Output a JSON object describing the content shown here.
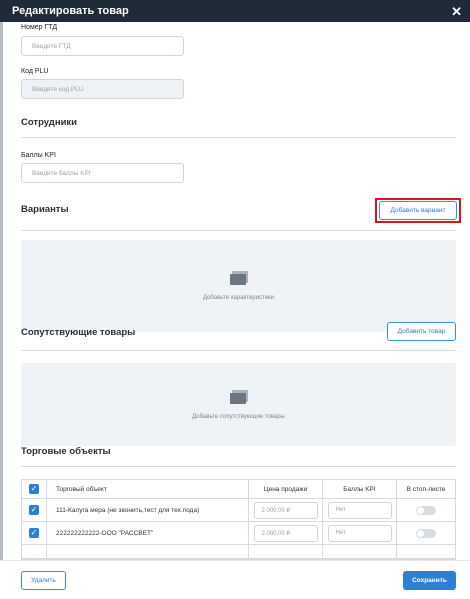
{
  "header": {
    "title": "Редактировать товар",
    "close_symbol": "✕"
  },
  "fields": {
    "gtd": {
      "label": "Номер ГТД",
      "placeholder": "Введите ГТД"
    },
    "plu": {
      "label": "Код PLU",
      "placeholder": "Введите код PLU"
    },
    "kpi": {
      "label": "Баллы KPI",
      "placeholder": "Введите баллы KPI"
    }
  },
  "sections": {
    "employees": "Сотрудники",
    "variants": {
      "title": "Варианты",
      "add_button": "Добавить вариант",
      "empty_text": "Добавьте характеристики"
    },
    "related": {
      "title": "Сопутствующие товары",
      "add_button": "Добавить товар",
      "empty_text": "Добавьте сопутствующие товары"
    },
    "outlets": {
      "title": "Торговые объекты",
      "columns": [
        "Торговый объект",
        "Цена продажи",
        "Баллы KPI",
        "В стоп-листе"
      ],
      "rows": [
        {
          "name": "111-Калуга мера (не звонить,тест для тех.пода)",
          "price": "2 000,00 ₽",
          "kpi": "Нет",
          "checked": true,
          "stop_list": false
        },
        {
          "name": "222222222222-ООО \"РАССВЕТ\"",
          "price": "2 000,00 ₽",
          "kpi": "Нет",
          "checked": true,
          "stop_list": false
        }
      ]
    }
  },
  "footer": {
    "delete_label": "Удалить",
    "save_label": "Сохранить"
  },
  "colors": {
    "header_bg": "#1f2a38",
    "accent": "#2d7fd3",
    "highlight": "#d9161f"
  }
}
